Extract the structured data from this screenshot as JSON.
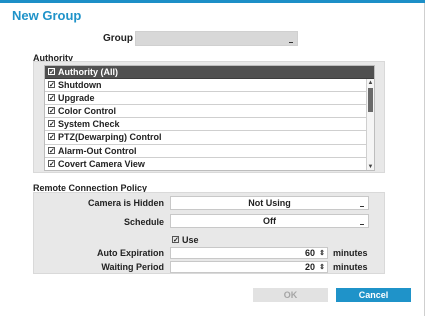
{
  "dialog": {
    "title": "New Group",
    "accent_color": "#1f93c9"
  },
  "group": {
    "label": "Group",
    "value": ""
  },
  "authority": {
    "section_label": "Authority",
    "items": [
      {
        "label": "Authority (All)",
        "checked": true
      },
      {
        "label": "Shutdown",
        "checked": true
      },
      {
        "label": "Upgrade",
        "checked": true
      },
      {
        "label": "Color Control",
        "checked": true
      },
      {
        "label": "System Check",
        "checked": true
      },
      {
        "label": "PTZ(Dewarping) Control",
        "checked": true
      },
      {
        "label": "Alarm-Out Control",
        "checked": true
      },
      {
        "label": "Covert Camera View",
        "checked": true
      }
    ]
  },
  "remote": {
    "section_label": "Remote Connection Policy",
    "camera_hidden_label": "Camera is Hidden",
    "camera_hidden_value": "Not Using",
    "schedule_label": "Schedule",
    "schedule_value": "Off",
    "use_label": "Use",
    "use_checked": true,
    "auto_expiration_label": "Auto Expiration",
    "auto_expiration_value": "60",
    "waiting_period_label": "Waiting Period",
    "waiting_period_value": "20",
    "unit_label": "minutes"
  },
  "buttons": {
    "ok": "OK",
    "cancel": "Cancel"
  }
}
